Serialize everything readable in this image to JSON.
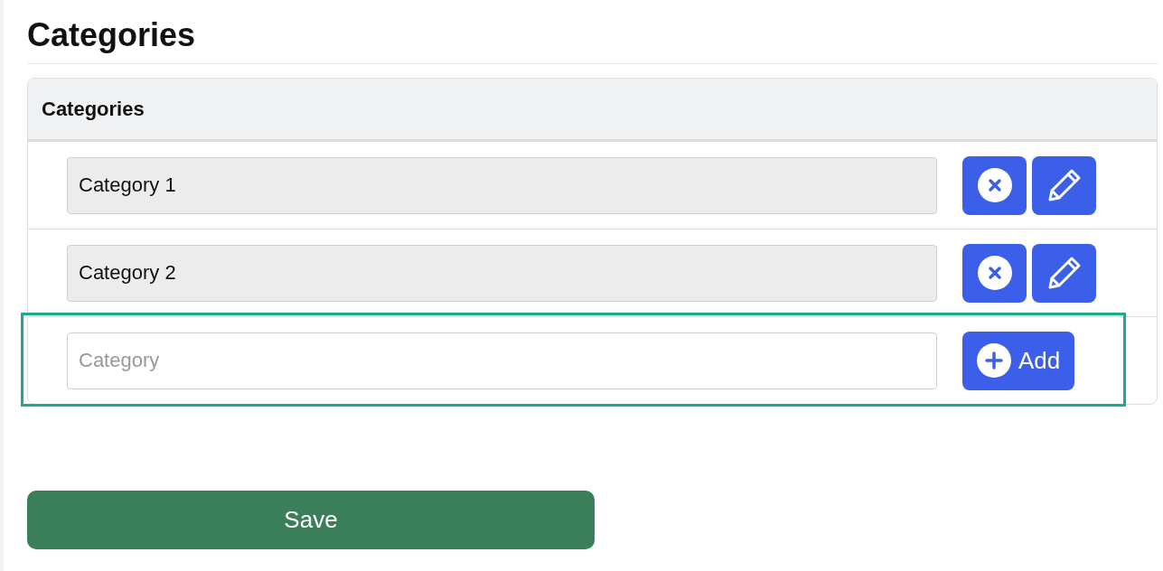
{
  "page_title": "Categories",
  "table": {
    "header": "Categories",
    "rows": [
      {
        "value": "Category 1"
      },
      {
        "value": "Category 2"
      }
    ],
    "new_row": {
      "placeholder": "Category",
      "add_label": "Add",
      "highlighted": true
    }
  },
  "save_label": "Save"
}
